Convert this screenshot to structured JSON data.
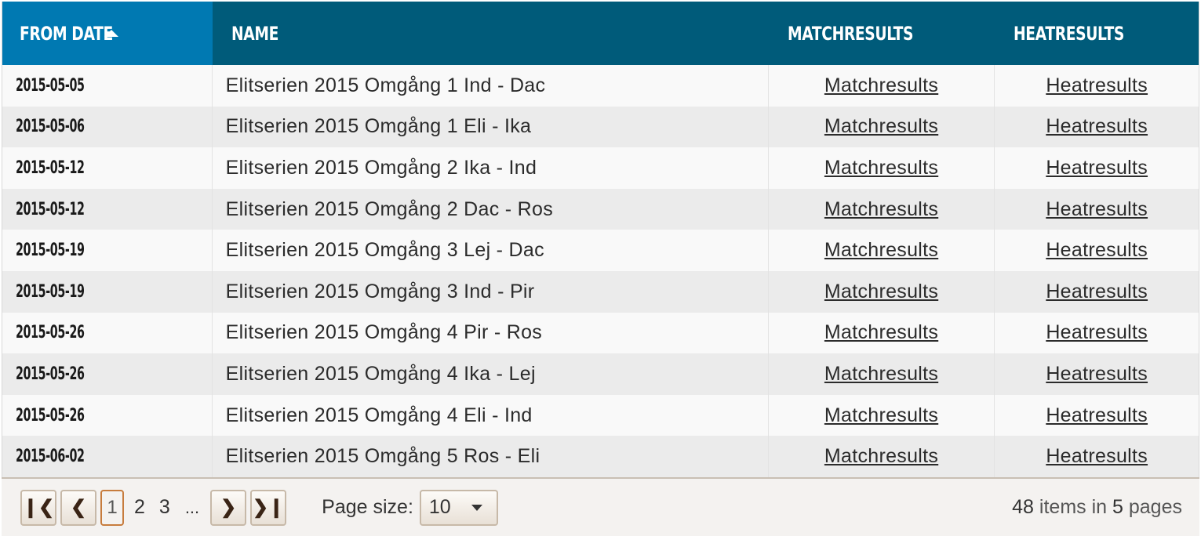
{
  "table": {
    "headers": {
      "from_date": "From date",
      "name": "Name",
      "matchresults": "Matchresults",
      "heatresults": "Heatresults"
    },
    "rows": [
      {
        "date": "2015-05-05",
        "name": "Elitserien 2015 Omgång 1 Ind - Dac",
        "match_link": "Matchresults",
        "heat_link": "Heatresults"
      },
      {
        "date": "2015-05-06",
        "name": "Elitserien 2015 Omgång 1 Eli - Ika",
        "match_link": "Matchresults",
        "heat_link": "Heatresults"
      },
      {
        "date": "2015-05-12",
        "name": "Elitserien 2015 Omgång 2 Ika - Ind",
        "match_link": "Matchresults",
        "heat_link": "Heatresults"
      },
      {
        "date": "2015-05-12",
        "name": "Elitserien 2015 Omgång 2 Dac - Ros",
        "match_link": "Matchresults",
        "heat_link": "Heatresults"
      },
      {
        "date": "2015-05-19",
        "name": "Elitserien 2015 Omgång 3 Lej - Dac",
        "match_link": "Matchresults",
        "heat_link": "Heatresults"
      },
      {
        "date": "2015-05-19",
        "name": "Elitserien 2015 Omgång 3 Ind - Pir",
        "match_link": "Matchresults",
        "heat_link": "Heatresults"
      },
      {
        "date": "2015-05-26",
        "name": "Elitserien 2015 Omgång 4 Pir - Ros",
        "match_link": "Matchresults",
        "heat_link": "Heatresults"
      },
      {
        "date": "2015-05-26",
        "name": "Elitserien 2015 Omgång 4 Ika - Lej",
        "match_link": "Matchresults",
        "heat_link": "Heatresults"
      },
      {
        "date": "2015-05-26",
        "name": "Elitserien 2015 Omgång 4 Eli - Ind",
        "match_link": "Matchresults",
        "heat_link": "Heatresults"
      },
      {
        "date": "2015-06-02",
        "name": "Elitserien 2015 Omgång 5 Ros - Eli",
        "match_link": "Matchresults",
        "heat_link": "Heatresults"
      }
    ]
  },
  "pager": {
    "pages": [
      "1",
      "2",
      "3"
    ],
    "current_page": "1",
    "ellipsis": "...",
    "page_size_label": "Page size:",
    "page_size_value": "10",
    "total_items": "48",
    "items_in_text": "items in",
    "total_pages": "5",
    "pages_text": "pages",
    "icons": {
      "first": "first-page-icon",
      "prev": "prev-page-icon",
      "next": "next-page-icon",
      "last": "last-page-icon",
      "sort": "sort-ascending-icon"
    }
  },
  "colors": {
    "header_bg": "#005b7a",
    "sorted_header_bg": "#0079b2",
    "current_page_border": "#c77c3d"
  }
}
